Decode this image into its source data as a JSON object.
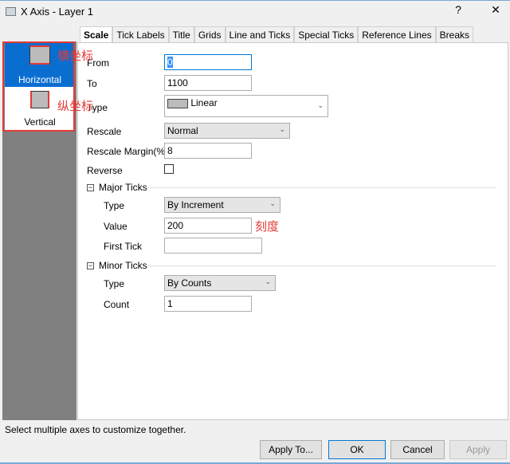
{
  "window": {
    "title": "X Axis - Layer 1",
    "help": "?",
    "close": "✕"
  },
  "sidebar": {
    "items": [
      {
        "label": "Horizontal"
      },
      {
        "label": "Vertical"
      }
    ]
  },
  "annotations": {
    "horizontal": "横坐标",
    "vertical": "纵坐标",
    "value": "刻度"
  },
  "tabs": [
    "Scale",
    "Tick Labels",
    "Title",
    "Grids",
    "Line and Ticks",
    "Special Ticks",
    "Reference Lines",
    "Breaks"
  ],
  "scale": {
    "from_label": "From",
    "from": "0",
    "to_label": "To",
    "to": "1100",
    "type_label": "Type",
    "type": "Linear",
    "rescale_label": "Rescale",
    "rescale": "Normal",
    "margin_label": "Rescale Margin(%)",
    "margin": "8",
    "reverse_label": "Reverse"
  },
  "major": {
    "title": "Major Ticks",
    "type_label": "Type",
    "type": "By Increment",
    "value_label": "Value",
    "value": "200",
    "first_label": "First Tick",
    "first": ""
  },
  "minor": {
    "title": "Minor Ticks",
    "type_label": "Type",
    "type": "By Counts",
    "count_label": "Count",
    "count": "1"
  },
  "status": "Select multiple axes to customize together.",
  "buttons": {
    "apply_to": "Apply To...",
    "ok": "OK",
    "cancel": "Cancel",
    "apply": "Apply"
  }
}
